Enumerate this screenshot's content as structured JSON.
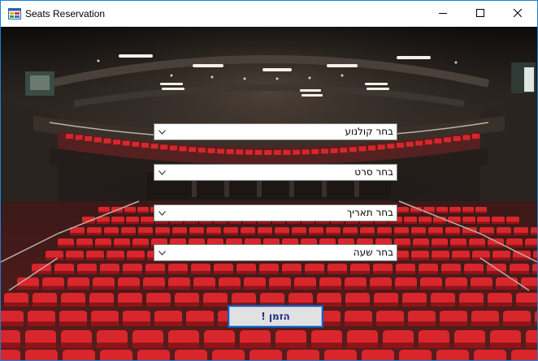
{
  "window": {
    "title": "Seats Reservation"
  },
  "form": {
    "cinema_combo": {
      "value": "בחר קולנוע"
    },
    "movie_combo": {
      "value": "בחר סרט"
    },
    "date_combo": {
      "value": "בחר תאריך"
    },
    "time_combo": {
      "value": "בחר שעה"
    },
    "order_button_label": "הזמן !"
  },
  "icons": {
    "app": "app-window-icon",
    "minimize": "minimize-icon",
    "maximize": "maximize-icon",
    "close": "close-icon",
    "dropdown": "chevron-down-icon"
  },
  "colors": {
    "seat_red": "#d8262c",
    "button_border": "#0a5fbf",
    "button_text": "#1a2a8a"
  }
}
